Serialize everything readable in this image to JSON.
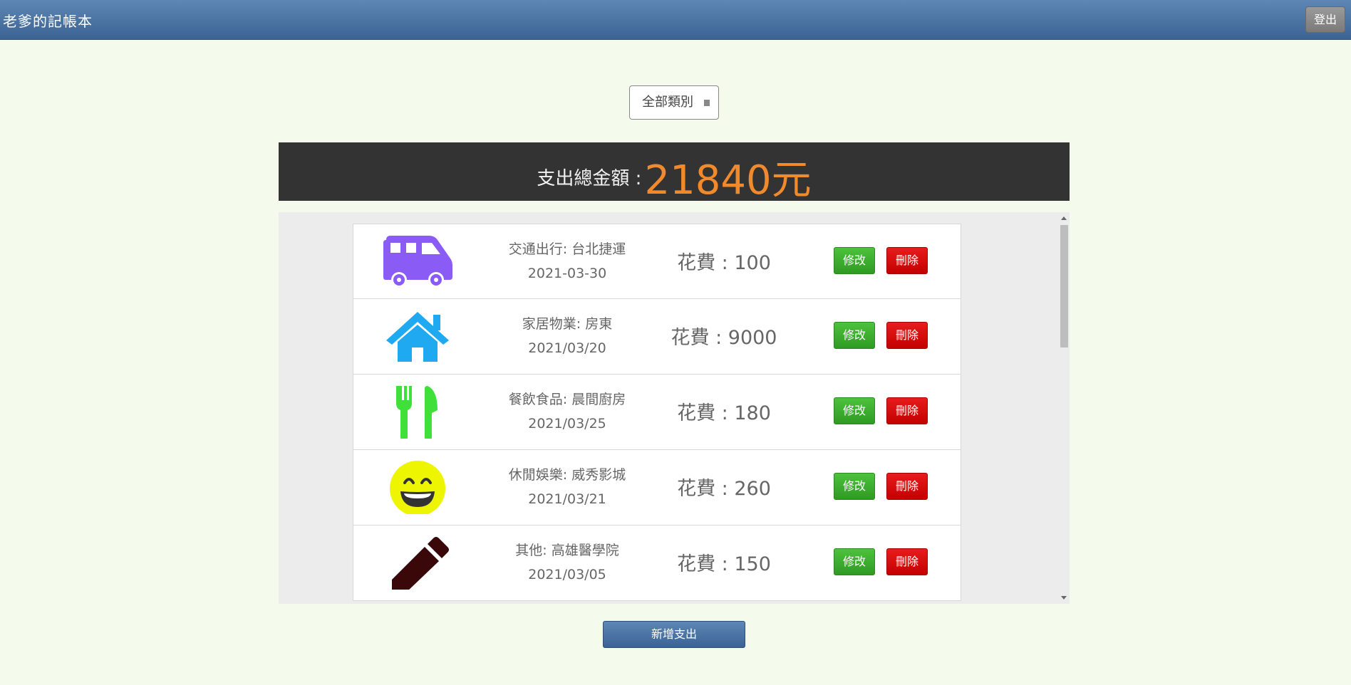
{
  "header": {
    "title": "老爹的記帳本",
    "logout_label": "登出"
  },
  "filter": {
    "selected": "全部類別"
  },
  "summary": {
    "label": "支出總金額 :",
    "amount": "21840元",
    "amount_color": "#f08a2c"
  },
  "expenses": [
    {
      "icon": "bus-icon",
      "icon_color": "#8a5cf5",
      "description": "交通出行: 台北捷運",
      "date": "2021-03-30",
      "cost": "花費 : 100",
      "edit_label": "修改",
      "delete_label": "刪除"
    },
    {
      "icon": "house-icon",
      "icon_color": "#1fa9f0",
      "description": "家居物業: 房東",
      "date": "2021/03/20",
      "cost": "花費 : 9000",
      "edit_label": "修改",
      "delete_label": "刪除"
    },
    {
      "icon": "utensils-icon",
      "icon_color": "#3fe03a",
      "description": "餐飲食品: 晨間廚房",
      "date": "2021/03/25",
      "cost": "花費 : 180",
      "edit_label": "修改",
      "delete_label": "刪除"
    },
    {
      "icon": "smile-icon",
      "icon_color": "#eef500",
      "description": "休閒娛樂: 威秀影城",
      "date": "2021/03/21",
      "cost": "花費 : 260",
      "edit_label": "修改",
      "delete_label": "刪除"
    },
    {
      "icon": "pencil-icon",
      "icon_color": "#3a0808",
      "description": "其他: 高雄醫學院",
      "date": "2021/03/05",
      "cost": "花費 : 150",
      "edit_label": "修改",
      "delete_label": "刪除"
    }
  ],
  "add_button_label": "新增支出"
}
